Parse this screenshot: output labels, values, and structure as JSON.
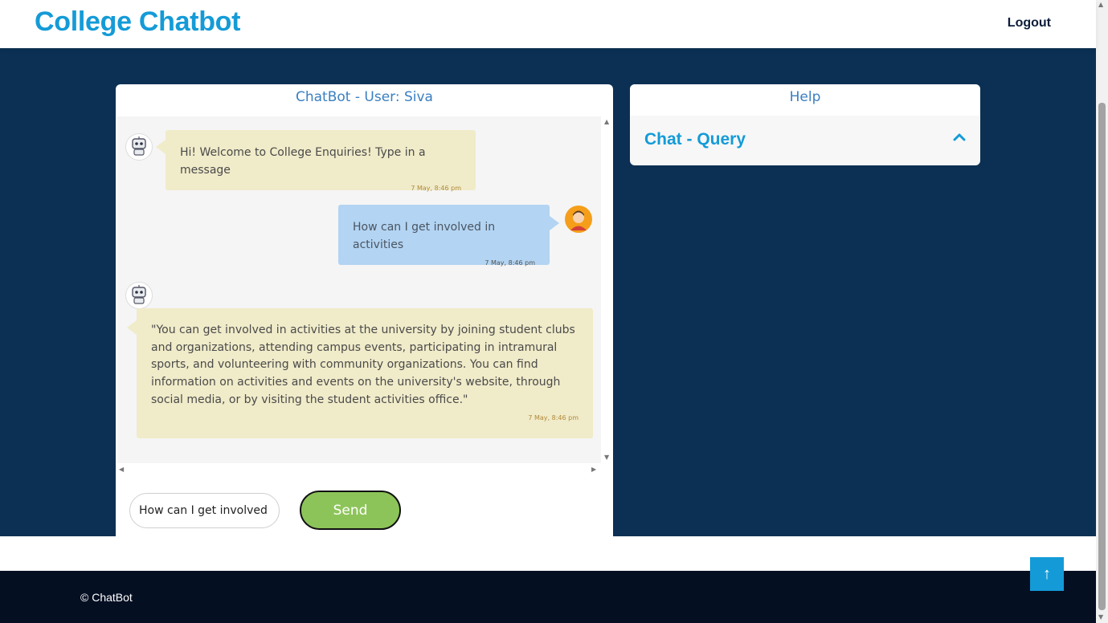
{
  "header": {
    "brand": "College Chatbot",
    "logout": "Logout"
  },
  "chat": {
    "title": "ChatBot - User: Siva",
    "messages": [
      {
        "sender": "bot",
        "text": "Hi! Welcome to College Enquiries! Type in a message",
        "time": "7 May, 8:46 pm"
      },
      {
        "sender": "user",
        "text": "How can I get involved in activities",
        "time": "7 May, 8:46 pm"
      },
      {
        "sender": "bot",
        "text": "\"You can get involved in activities at the university by joining student clubs and organizations, attending campus events, participating in intramural sports, and volunteering with community organizations. You can find information on activities and events on the university's website, through social media, or by visiting the student activities office.\"",
        "time": "7 May, 8:46 pm"
      }
    ],
    "input_value": "How can I get involved in activities",
    "send_label": "Send"
  },
  "help": {
    "title": "Help",
    "section": "Chat - Query"
  },
  "footer": {
    "copyright": "© ChatBot"
  },
  "icons": {
    "bot_avatar": "robot-icon",
    "user_avatar": "user-icon",
    "chevron": "chevron-up-icon",
    "to_top": "arrow-up-icon"
  },
  "colors": {
    "brand": "#149bd7",
    "hero_bg": "#0b3054",
    "footer_bg": "#050f22",
    "bot_bubble": "#f0ebc9",
    "user_bubble": "#b3d4f2",
    "send_button": "#8dc45a"
  }
}
